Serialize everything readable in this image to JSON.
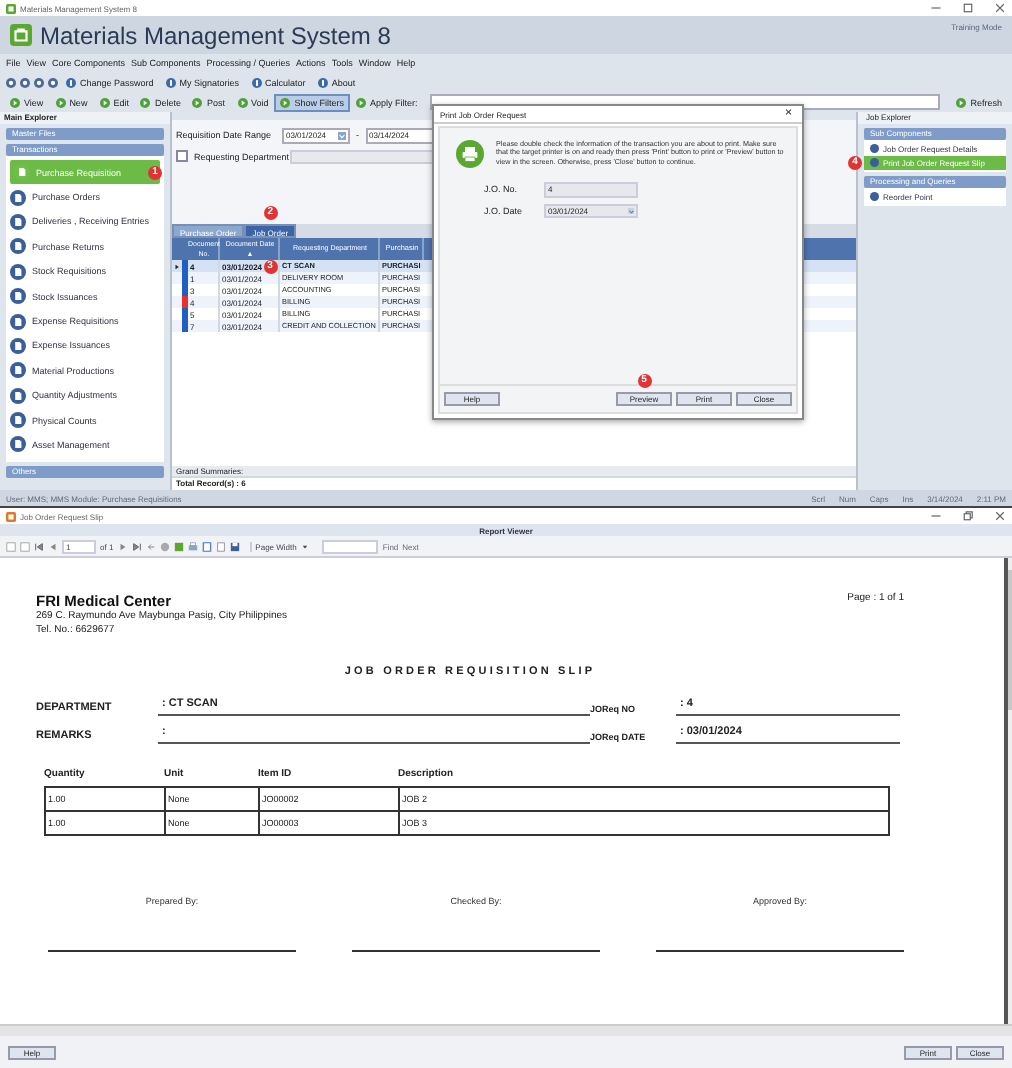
{
  "app_window": {
    "title": "Materials Management System 8",
    "app_name": "Materials Management System 8",
    "mode": "Training Mode"
  },
  "menu": [
    "File",
    "View",
    "Core Components",
    "Sub Components",
    "Processing / Queries",
    "Actions",
    "Tools",
    "Window",
    "Help"
  ],
  "toolbar_top": [
    "Change Password",
    "My Signatories",
    "Calculator",
    "About"
  ],
  "toolbar_actions": [
    {
      "label": "View",
      "selected": false
    },
    {
      "label": "New",
      "selected": false
    },
    {
      "label": "Edit",
      "selected": false
    },
    {
      "label": "Delete",
      "selected": false
    },
    {
      "label": "Post",
      "selected": false
    },
    {
      "label": "Void",
      "selected": false
    },
    {
      "label": "Show Filters",
      "selected": true
    },
    {
      "label": "Apply Filter:",
      "selected": false
    }
  ],
  "refresh": "Refresh",
  "sidebar": {
    "title": "Main Explorer",
    "sections": [
      {
        "label": "Master Files"
      },
      {
        "label": "Transactions",
        "items": [
          {
            "label": "Purchase Requisition",
            "selected": true,
            "step": "1"
          },
          {
            "label": "Purchase Orders",
            "selected": false
          },
          {
            "label": "Deliveries , Receiving Entries",
            "selected": false
          },
          {
            "label": "Purchase Returns",
            "selected": false
          },
          {
            "label": "Stock Requisitions",
            "selected": false
          },
          {
            "label": "Stock Issuances",
            "selected": false
          },
          {
            "label": "Expense Requisitions",
            "selected": false
          },
          {
            "label": "Expense Issuances",
            "selected": false
          },
          {
            "label": "Material Productions",
            "selected": false
          },
          {
            "label": "Quantity Adjustments",
            "selected": false
          },
          {
            "label": "Physical Counts",
            "selected": false
          },
          {
            "label": "Asset Management",
            "selected": false
          }
        ]
      },
      {
        "label": "Others"
      }
    ]
  },
  "filters": {
    "date_label": "Requisition Date Range",
    "date_from": "03/01/2024",
    "date_separator": "-",
    "date_to": "03/14/2024",
    "department_label": "Requesting Department",
    "department_checked": false
  },
  "tabs": [
    {
      "label": "Purchase Order",
      "selected": false
    },
    {
      "label": "Job Order",
      "selected": true,
      "step": "2"
    }
  ],
  "grid": {
    "columns": [
      "Document No.",
      "Document Date ▲",
      "Requesting Department",
      "Purchasin"
    ],
    "rows": [
      {
        "cells": [
          "4",
          "03/01/2024",
          "CT SCAN",
          "PURCHASI"
        ],
        "color": "#1f5fc4",
        "selected": true,
        "step": "3"
      },
      {
        "cells": [
          "1",
          "03/01/2024",
          "DELIVERY ROOM",
          "PURCHASI"
        ],
        "color": "#1f5fc4",
        "selected": false
      },
      {
        "cells": [
          "3",
          "03/01/2024",
          "ACCOUNTING",
          "PURCHASI"
        ],
        "color": "#1f5fc4",
        "selected": false
      },
      {
        "cells": [
          "4",
          "03/01/2024",
          "BILLING",
          "PURCHASI"
        ],
        "color": "#e8302c",
        "selected": false
      },
      {
        "cells": [
          "5",
          "03/01/2024",
          "BILLING",
          "PURCHASI"
        ],
        "color": "#1f5fc4",
        "selected": false
      },
      {
        "cells": [
          "7",
          "03/01/2024",
          "CREDIT AND COLLECTION",
          "PURCHASI"
        ],
        "color": "#1f5fc4",
        "selected": false
      }
    ],
    "summary_label": "Grand Summaries:",
    "total": "Total Record(s) : 6"
  },
  "dialog": {
    "title": "Print Job Order Request",
    "close": "×",
    "message": "Please double check the information of the transaction you are about to print. Make sure that the target printer is on and ready then press 'Print' button to print or 'Preview' button to view in the screen. Otherwise, press 'Close' button to continue.",
    "fields": [
      {
        "label": "J.O. No.",
        "value": "4",
        "kind": "text"
      },
      {
        "label": "J.O. Date",
        "value": "03/01/2024",
        "kind": "date"
      }
    ],
    "buttons": [
      {
        "label": "Help"
      },
      {
        "label": "Preview",
        "step": "5"
      },
      {
        "label": "Print"
      },
      {
        "label": "Close"
      }
    ]
  },
  "job_explorer": {
    "title": "Job Explorer",
    "sections": [
      {
        "label": "Sub Components",
        "items": [
          {
            "label": "Job Order Request Details",
            "selected": false
          },
          {
            "label": "Print Job Order Request Slip",
            "selected": true,
            "step": "4"
          }
        ]
      },
      {
        "label": "Processing and Queries",
        "items": [
          {
            "label": "Reorder Point",
            "selected": false
          }
        ]
      }
    ]
  },
  "status_bar": {
    "user": "User: MMS; MMS Module: Purchase Requisitions",
    "indicators": [
      "Scrl",
      "Num",
      "Caps",
      "Ins",
      "3/14/2024",
      "2:11 PM"
    ]
  },
  "report_window": {
    "title": "Job Order Request Slip",
    "viewer_title": "Report Viewer",
    "page": "1",
    "page_of": "of 1",
    "zoom": "Page Width",
    "find": "Find",
    "next": "Next",
    "report": {
      "company": "FRI Medical Center",
      "address": "269 C. Raymundo Ave Maybunga Pasig, City Philippines",
      "tel": "Tel. No.: 6629677",
      "page_label": "Page : 1 of 1",
      "title": "JOB ORDER REQUISITION SLIP",
      "department_label": "DEPARTMENT",
      "department": ": CT SCAN",
      "joreq_no_label": "JOReq NO",
      "joreq_no": ": 4",
      "remarks_label": "REMARKS",
      "remarks": ":",
      "joreq_date_label": "JOReq DATE",
      "joreq_date": ": 03/01/2024",
      "columns": [
        "Quantity",
        "Unit",
        "Item ID",
        "Description"
      ],
      "rows": [
        [
          "1.00",
          "None",
          "JO00002",
          "JOB 2"
        ],
        [
          "1.00",
          "None",
          "JO00003",
          "JOB 3"
        ]
      ],
      "signatures": [
        "Prepared By:",
        "Checked By:",
        "Approved By:"
      ]
    },
    "buttons_left": [
      "Help"
    ],
    "buttons_right": [
      "Print",
      "Close"
    ]
  }
}
